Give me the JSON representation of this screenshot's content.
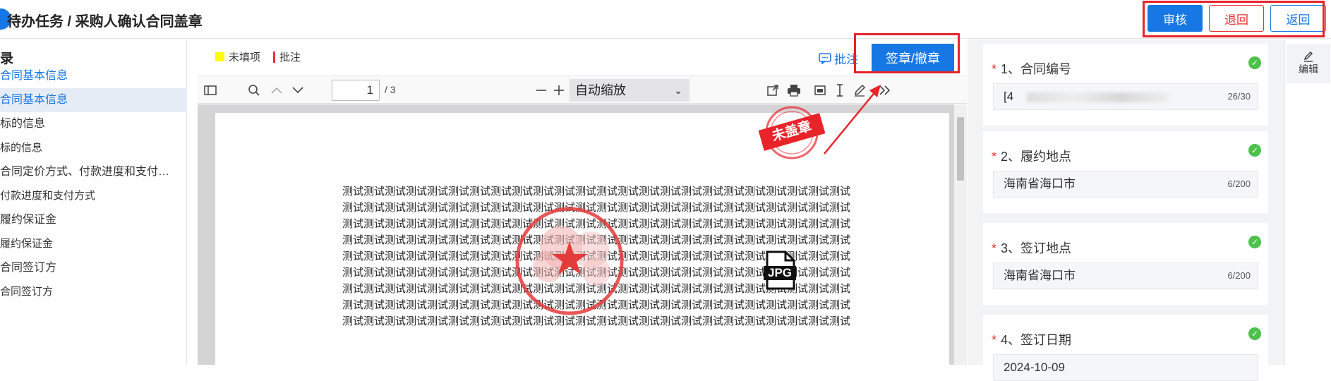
{
  "header": {
    "title": "待办任务 / 采购人确认合同盖章",
    "audit_label": "审核",
    "return_label": "退回",
    "back_label": "返回"
  },
  "sidebar": {
    "heading": "录",
    "items": [
      {
        "label": "合同基本信息",
        "style": "active"
      },
      {
        "label": "合同基本信息",
        "style": "selected"
      },
      {
        "label": "标的信息",
        "style": "normal"
      },
      {
        "label": "标的信息",
        "style": "sub"
      },
      {
        "label": "合同定价方式、付款进度和支付…",
        "style": "normal"
      },
      {
        "label": "付款进度和支付方式",
        "style": "sub"
      },
      {
        "label": "履约保证金",
        "style": "normal"
      },
      {
        "label": "履约保证金",
        "style": "sub"
      },
      {
        "label": "合同签订方",
        "style": "normal"
      },
      {
        "label": "合同签订方",
        "style": "sub"
      }
    ]
  },
  "viewer": {
    "legend_unfilled": "未填项",
    "legend_annotation": "批注",
    "annotation_link": "批注",
    "sign_button": "签章/撤章",
    "page_number": "1",
    "page_total": "/ 3",
    "zoom": "自动缩放",
    "unstamped_stamp": "未盖章",
    "jpg_label": "JPG",
    "body_line": "测试测试测试测试测试测试测试测试测试测试测试测试测试测试测试测试测试测试测试测试测试测试测试测试测试测试测试测试测试测试",
    "line_count": 9
  },
  "form": {
    "fields": [
      {
        "label": "1、合同编号",
        "value": "[4",
        "counter": "26/30"
      },
      {
        "label": "2、履约地点",
        "value": "海南省海口市",
        "counter": "6/200"
      },
      {
        "label": "3、签订地点",
        "value": "海南省海口市",
        "counter": "6/200"
      },
      {
        "label": "4、签订日期",
        "value": "2024-10-09",
        "counter": ""
      }
    ],
    "required_mark": "*",
    "edit_label": "编辑"
  },
  "colors": {
    "primary": "#1677e5",
    "danger": "#e8312f",
    "highlight": "#ffff00",
    "success": "#4cc14c"
  }
}
